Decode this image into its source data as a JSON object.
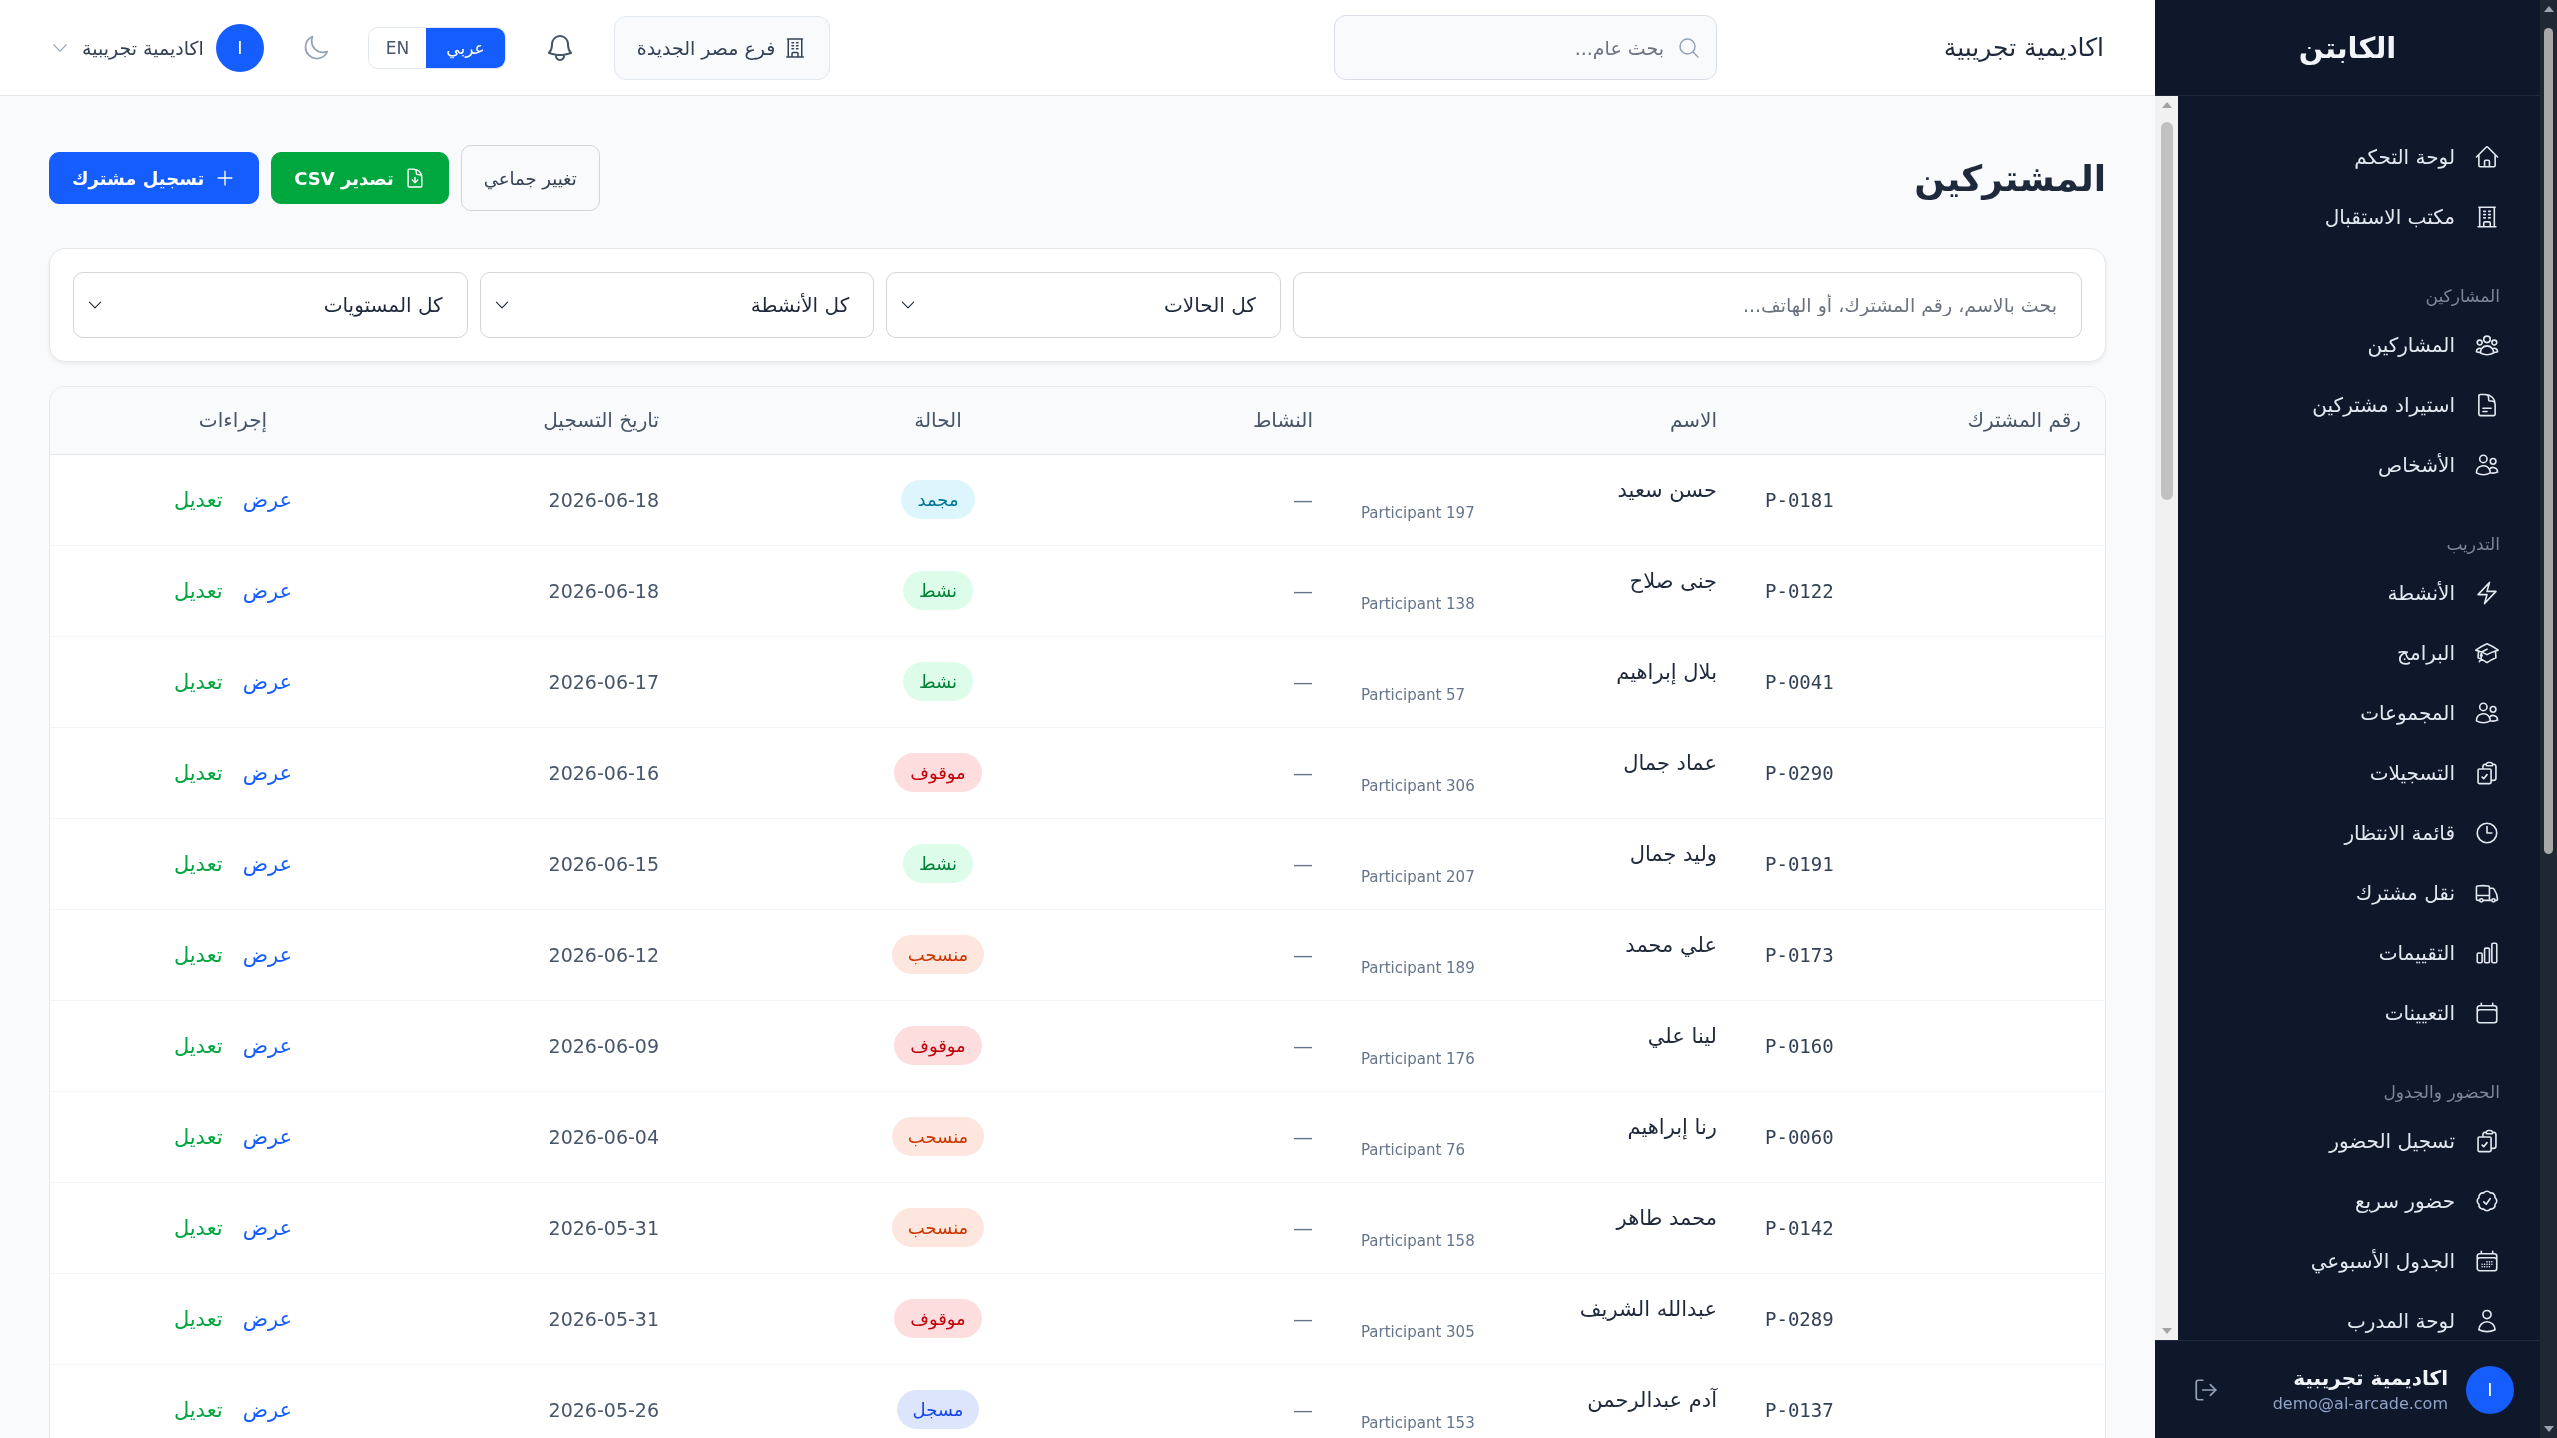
{
  "sidebar": {
    "brand": "الكابتن",
    "groups": [
      {
        "items": [
          "لوحة التحكم",
          "مكتب الاستقبال"
        ]
      },
      {
        "title": "المشاركين",
        "items": [
          "المشاركين",
          "استيراد مشتركين",
          "الأشخاص"
        ]
      },
      {
        "title": "التدريب",
        "items": [
          "الأنشطة",
          "البرامج",
          "المجموعات",
          "التسجيلات",
          "قائمة الانتظار",
          "نقل مشترك",
          "التقييمات",
          "التعيينات"
        ]
      },
      {
        "title": "الحضور والجدول",
        "items": [
          "تسجيل الحضور",
          "حضور سريع",
          "الجدول الأسبوعي",
          "لوحة المدرب"
        ]
      }
    ],
    "user": {
      "avatar": "I",
      "name": "اكاديمية تجريبية",
      "email": "demo@al-arcade.com"
    }
  },
  "topbar": {
    "title": "اكاديمية تجريبية",
    "search": {
      "placeholder": "بحث عام..."
    },
    "branch": "فرع مصر الجديدة",
    "languages": [
      {
        "label": "عربي",
        "selected": true
      },
      {
        "label": "EN",
        "selected": false
      }
    ],
    "user": {
      "avatar": "I",
      "name": "اكاديمية تجريبية"
    }
  },
  "page": {
    "title": "المشتركين",
    "actions": [
      {
        "label": "تغيير جماعي",
        "kind": "secondary"
      },
      {
        "label": "تصدير CSV",
        "kind": "export"
      },
      {
        "label": "تسجيل مشترك",
        "kind": "primary"
      }
    ]
  },
  "filters": {
    "search": {
      "placeholder": "بحث بالاسم، رقم المشترك، أو الهاتف..."
    },
    "selects": [
      "كل الحالات",
      "كل الأنشطة",
      "كل المستويات"
    ]
  },
  "table": {
    "columns": [
      "رقم المشترك",
      "الاسم",
      "النشاط",
      "الحالة",
      "تاريخ التسجيل",
      "إجراءات"
    ],
    "rows": [
      {
        "id": "P-0181",
        "name": "حسن سعيد",
        "subtitle": "Participant 197",
        "activity": "—",
        "status": {
          "label": "مجمد",
          "color": "#007595"
        },
        "date": "2026-06-18",
        "actions": [
          {
            "label": "عرض",
            "kind": "view"
          },
          {
            "label": "تعديل",
            "kind": "edit"
          }
        ]
      },
      {
        "id": "P-0122",
        "name": "جنى صلاح",
        "subtitle": "Participant 138",
        "activity": "—",
        "status": {
          "label": "نشط",
          "color": "#008236"
        },
        "date": "2026-06-18",
        "actions": [
          {
            "label": "عرض",
            "kind": "view"
          },
          {
            "label": "تعديل",
            "kind": "edit"
          }
        ]
      },
      {
        "id": "P-0041",
        "name": "بلال إبراهيم",
        "subtitle": "Participant 57",
        "activity": "—",
        "status": {
          "label": "نشط",
          "color": "#008236"
        },
        "date": "2026-06-17",
        "actions": [
          {
            "label": "عرض",
            "kind": "view"
          },
          {
            "label": "تعديل",
            "kind": "edit"
          }
        ]
      },
      {
        "id": "P-0290",
        "name": "عماد جمال",
        "subtitle": "Participant 306",
        "activity": "—",
        "status": {
          "label": "موقوف",
          "color": "#c10007"
        },
        "date": "2026-06-16",
        "actions": [
          {
            "label": "عرض",
            "kind": "view"
          },
          {
            "label": "تعديل",
            "kind": "edit"
          }
        ]
      },
      {
        "id": "P-0191",
        "name": "وليد جمال",
        "subtitle": "Participant 207",
        "activity": "—",
        "status": {
          "label": "نشط",
          "color": "#008236"
        },
        "date": "2026-06-15",
        "actions": [
          {
            "label": "عرض",
            "kind": "view"
          },
          {
            "label": "تعديل",
            "kind": "edit"
          }
        ]
      },
      {
        "id": "P-0173",
        "name": "علي محمد",
        "subtitle": "Participant 189",
        "activity": "—",
        "status": {
          "label": "منسحب",
          "color": "#ca3500"
        },
        "date": "2026-06-12",
        "actions": [
          {
            "label": "عرض",
            "kind": "view"
          },
          {
            "label": "تعديل",
            "kind": "edit"
          }
        ]
      },
      {
        "id": "P-0160",
        "name": "لينا علي",
        "subtitle": "Participant 176",
        "activity": "—",
        "status": {
          "label": "موقوف",
          "color": "#c10007"
        },
        "date": "2026-06-09",
        "actions": [
          {
            "label": "عرض",
            "kind": "view"
          },
          {
            "label": "تعديل",
            "kind": "edit"
          }
        ]
      },
      {
        "id": "P-0060",
        "name": "رنا إبراهيم",
        "subtitle": "Participant 76",
        "activity": "—",
        "status": {
          "label": "منسحب",
          "color": "#ca3500"
        },
        "date": "2026-06-04",
        "actions": [
          {
            "label": "عرض",
            "kind": "view"
          },
          {
            "label": "تعديل",
            "kind": "edit"
          }
        ]
      },
      {
        "id": "P-0142",
        "name": "محمد طاهر",
        "subtitle": "Participant 158",
        "activity": "—",
        "status": {
          "label": "منسحب",
          "color": "#ca3500"
        },
        "date": "2026-05-31",
        "actions": [
          {
            "label": "عرض",
            "kind": "view"
          },
          {
            "label": "تعديل",
            "kind": "edit"
          }
        ]
      },
      {
        "id": "P-0289",
        "name": "عبدالله الشريف",
        "subtitle": "Participant 305",
        "activity": "—",
        "status": {
          "label": "موقوف",
          "color": "#c10007"
        },
        "date": "2026-05-31",
        "actions": [
          {
            "label": "عرض",
            "kind": "view"
          },
          {
            "label": "تعديل",
            "kind": "edit"
          }
        ]
      },
      {
        "id": "P-0137",
        "name": "آدم عبدالرحمن",
        "subtitle": "Participant 153",
        "activity": "—",
        "status": {
          "label": "مسجل",
          "color": "#1447e6"
        },
        "date": "2026-05-26",
        "actions": [
          {
            "label": "عرض",
            "kind": "view"
          },
          {
            "label": "تعديل",
            "kind": "edit"
          }
        ]
      }
    ]
  }
}
